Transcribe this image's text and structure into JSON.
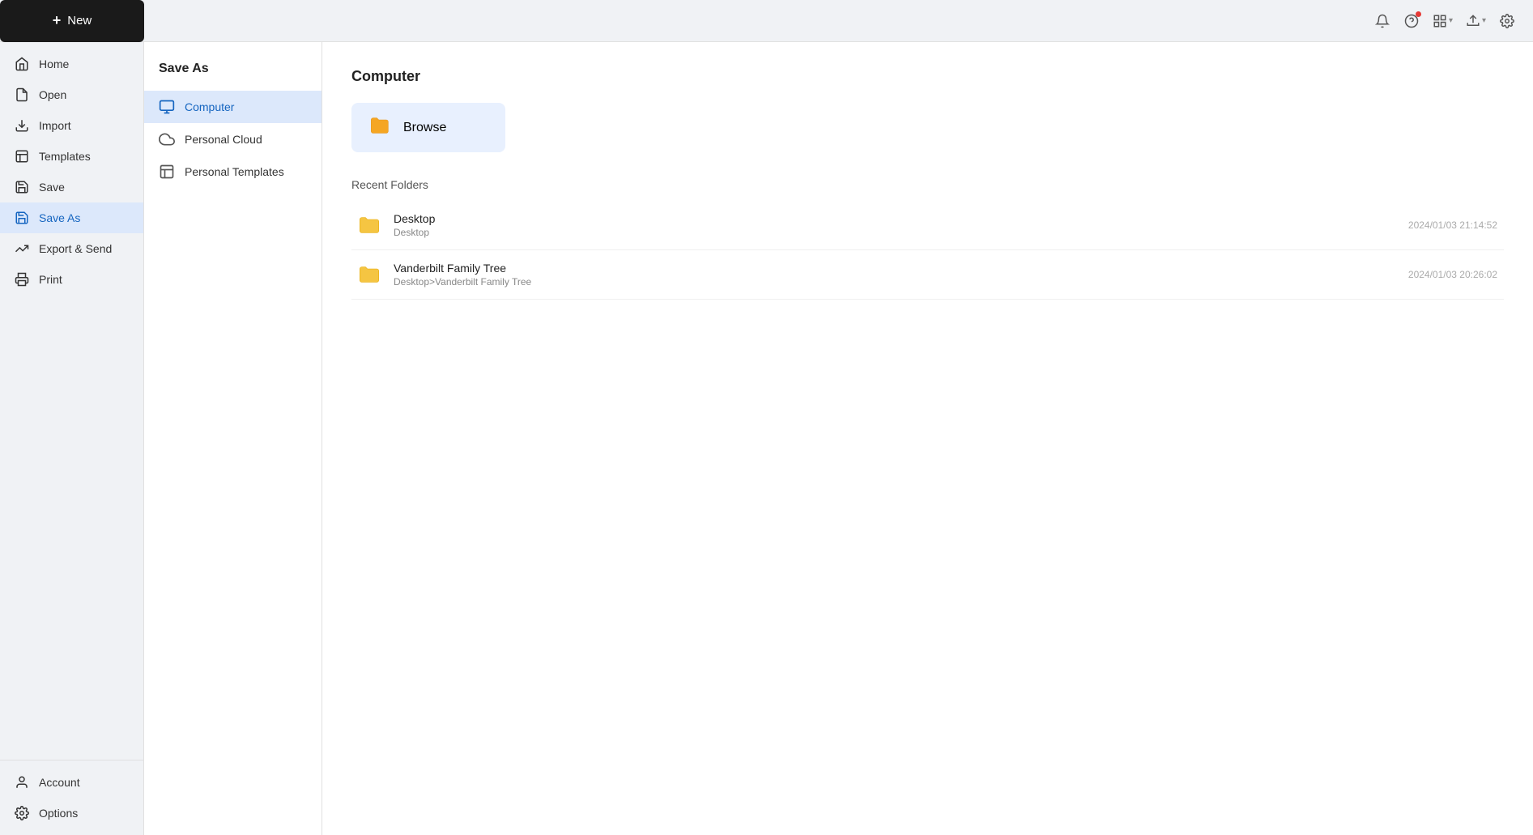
{
  "topbar": {
    "new_label": "New",
    "new_plus": "＋",
    "icons": {
      "bell": "🔔",
      "question": "?",
      "apps": "⠿",
      "tray": "⊡",
      "gear": "⚙"
    }
  },
  "sidebar": {
    "items": [
      {
        "id": "home",
        "label": "Home"
      },
      {
        "id": "open",
        "label": "Open"
      },
      {
        "id": "import",
        "label": "Import"
      },
      {
        "id": "templates",
        "label": "Templates"
      },
      {
        "id": "save",
        "label": "Save"
      },
      {
        "id": "save-as",
        "label": "Save As",
        "active": true
      },
      {
        "id": "export-send",
        "label": "Export & Send"
      },
      {
        "id": "print",
        "label": "Print"
      }
    ],
    "bottom_items": [
      {
        "id": "account",
        "label": "Account"
      },
      {
        "id": "options",
        "label": "Options"
      }
    ]
  },
  "middle_panel": {
    "title": "Save As",
    "items": [
      {
        "id": "computer",
        "label": "Computer",
        "active": true
      },
      {
        "id": "personal-cloud",
        "label": "Personal Cloud"
      },
      {
        "id": "personal-templates",
        "label": "Personal Templates"
      }
    ]
  },
  "content": {
    "title": "Computer",
    "browse_label": "Browse",
    "recent_folders_label": "Recent Folders",
    "folders": [
      {
        "name": "Desktop",
        "path": "Desktop",
        "date": "2024/01/03 21:14:52"
      },
      {
        "name": "Vanderbilt Family Tree",
        "path": "Desktop>Vanderbilt Family Tree",
        "date": "2024/01/03 20:26:02"
      }
    ]
  }
}
